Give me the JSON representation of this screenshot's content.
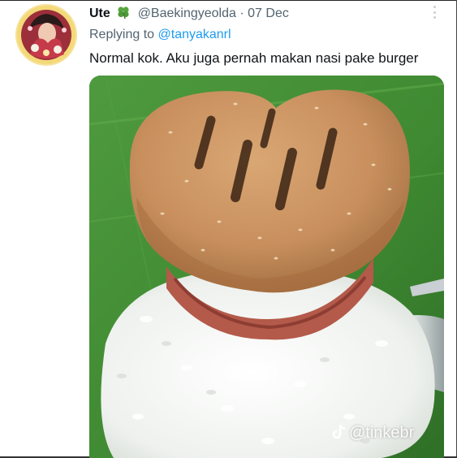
{
  "tweet": {
    "display_name": "Ute",
    "handle": "@Baekingyeolda",
    "separator": "·",
    "date": "07 Dec",
    "replying_prefix": "Replying to",
    "replying_to": "@tanyakanrl",
    "text": "Normal kok. Aku juga pernah makan nasi pake burger"
  },
  "media": {
    "watermark_text": "@tinkebr",
    "watermark_icon": "tiktok-icon",
    "content": "heart-shaped-burger-on-rice-photo"
  },
  "icons": {
    "name_badge": "clover-icon",
    "more": "more-vertical-icon"
  },
  "colors": {
    "link": "#1d9bf0",
    "muted": "#536471",
    "text": "#0f1419"
  }
}
